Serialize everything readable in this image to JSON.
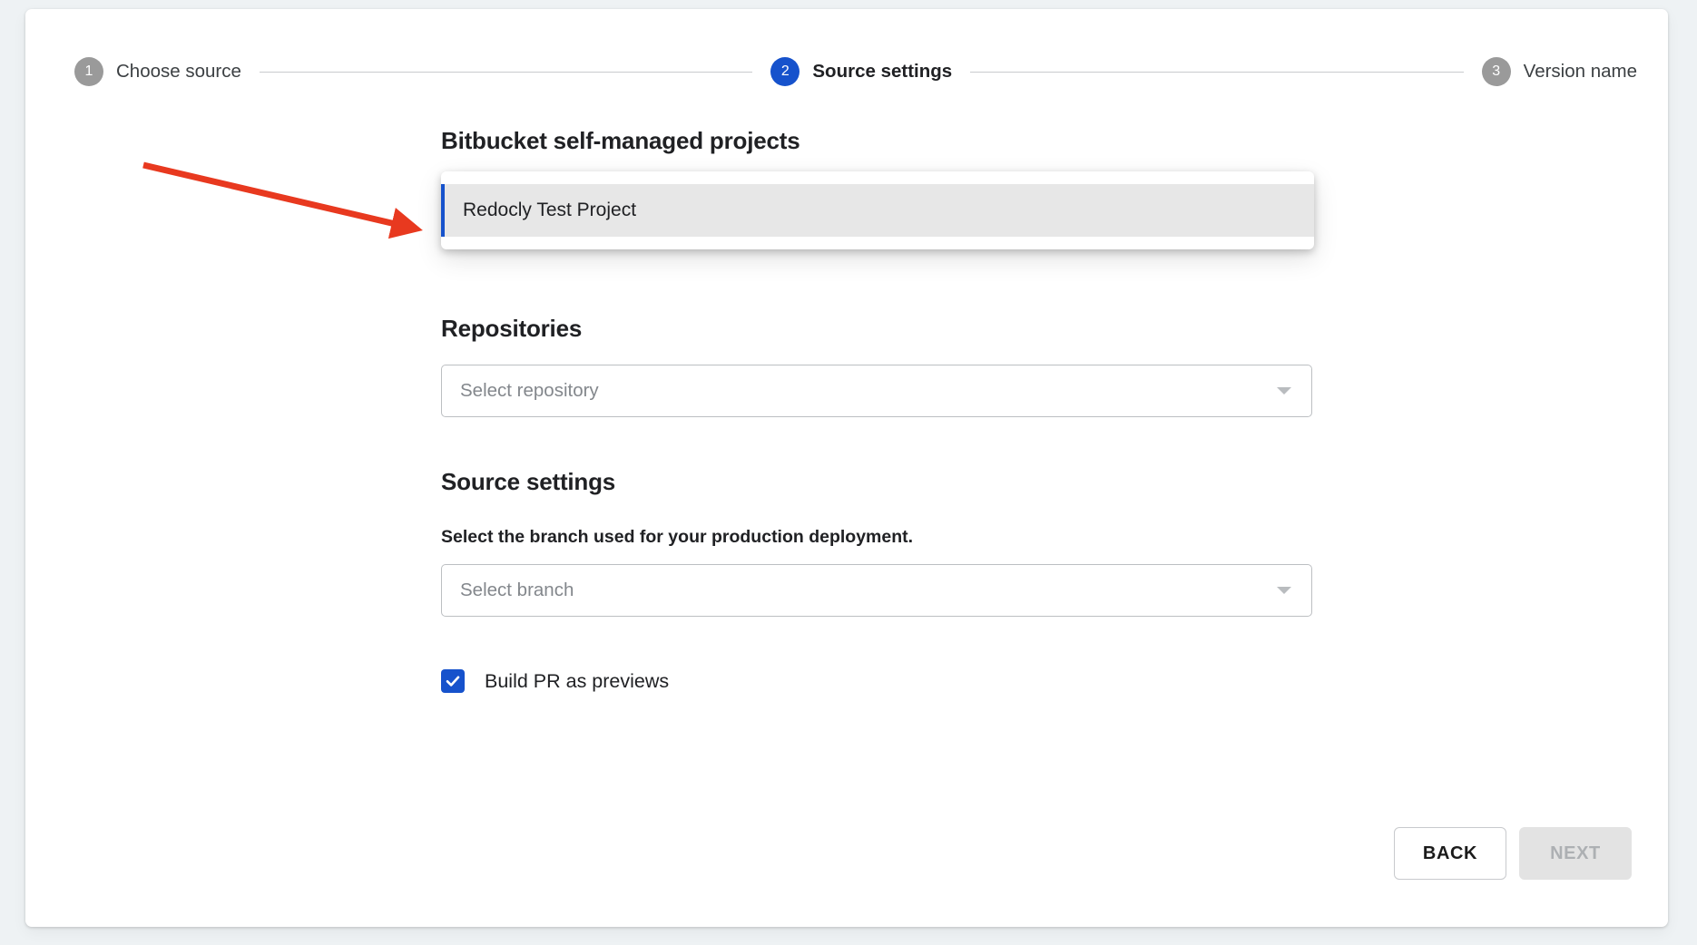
{
  "stepper": {
    "steps": [
      {
        "number": "1",
        "label": "Choose source",
        "state": "inactive"
      },
      {
        "number": "2",
        "label": "Source settings",
        "state": "active"
      },
      {
        "number": "3",
        "label": "Version name",
        "state": "inactive"
      }
    ]
  },
  "sections": {
    "projects": {
      "heading": "Bitbucket self-managed projects",
      "options": [
        {
          "label": "Redocly Test Project",
          "selected": true
        }
      ]
    },
    "repositories": {
      "heading": "Repositories",
      "select_placeholder": "Select repository",
      "caret": "chevron-down-icon"
    },
    "source_settings": {
      "heading": "Source settings",
      "branch_label": "Select the branch used for your production deployment.",
      "select_placeholder": "Select branch",
      "caret": "chevron-down-icon"
    },
    "build_pr": {
      "label": "Build PR as previews",
      "checked": true,
      "check_icon": "checkmark-icon"
    }
  },
  "footer": {
    "back_label": "BACK",
    "next_label": "NEXT",
    "next_disabled": true
  },
  "annotation": {
    "type": "arrow",
    "color": "#e8391f",
    "points_to": "Redocly Test Project option"
  },
  "colors": {
    "page_background": "#eef2f4",
    "card_background": "#ffffff",
    "accent_blue": "#1652cc",
    "step_inactive_gray": "#9a9a9a",
    "option_highlight": "#e7e7e7",
    "annotation_red": "#e8391f",
    "disabled_button": "#e3e3e3"
  }
}
